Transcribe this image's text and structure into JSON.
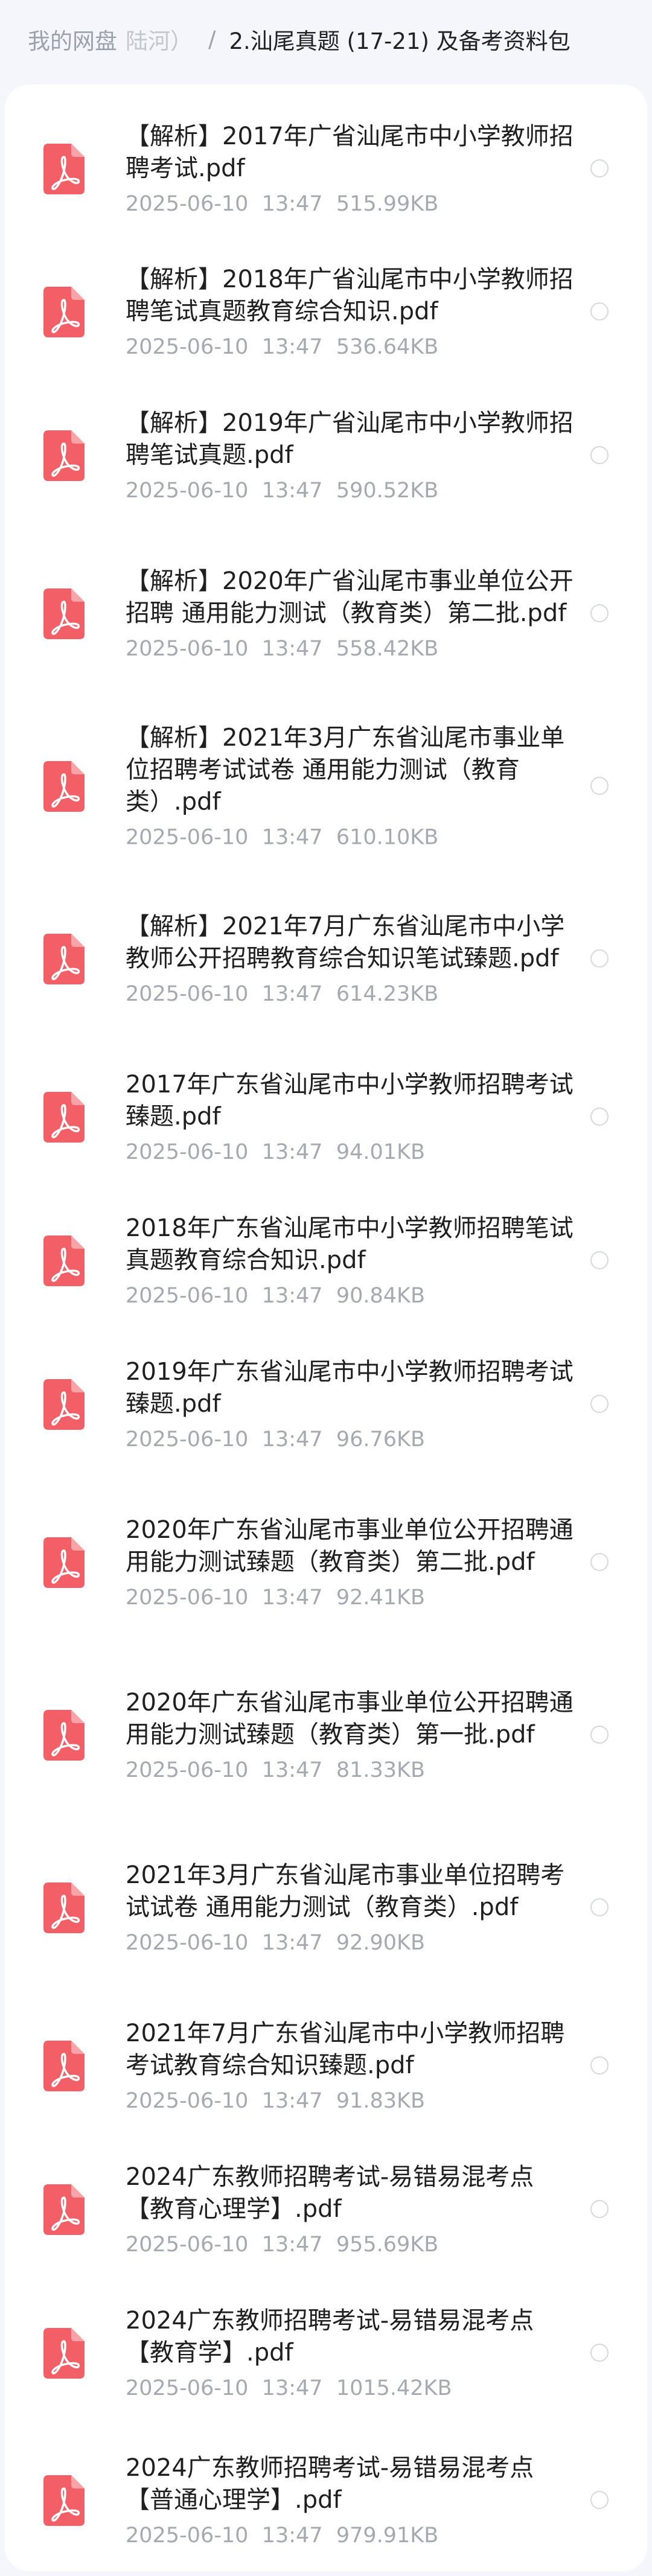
{
  "breadcrumb": {
    "root": "我的网盘",
    "middle": "陆河）",
    "separator": "/",
    "current": "2.汕尾真题 (17-21) 及备考资料包"
  },
  "colors": {
    "pdf_icon": "#f25f66",
    "background": "#f4f6fb"
  },
  "files": [
    {
      "name": "【解析】2017年广省汕尾市中小学教师招聘考试.pdf",
      "date": "2025-06-10",
      "time": "13:47",
      "size": "515.99KB",
      "icon": "pdf-icon"
    },
    {
      "name": "【解析】2018年广省汕尾市中小学教师招聘笔试真题教育综合知识.pdf",
      "date": "2025-06-10",
      "time": "13:47",
      "size": "536.64KB",
      "icon": "pdf-icon"
    },
    {
      "name": "【解析】2019年广省汕尾市中小学教师招聘笔试真题.pdf",
      "date": "2025-06-10",
      "time": "13:47",
      "size": "590.52KB",
      "icon": "pdf-icon"
    },
    {
      "name": "【解析】2020年广省汕尾市事业单位公开招聘 通用能力测试（教育类）第二批.pdf",
      "date": "2025-06-10",
      "time": "13:47",
      "size": "558.42KB",
      "icon": "pdf-icon"
    },
    {
      "name": "【解析】2021年3月广东省汕尾市事业单位招聘考试试卷 通用能力测试（教育类）.pdf",
      "date": "2025-06-10",
      "time": "13:47",
      "size": "610.10KB",
      "icon": "pdf-icon"
    },
    {
      "name": "【解析】2021年7月广东省汕尾市中小学教师公开招聘教育综合知识笔试臻题.pdf",
      "date": "2025-06-10",
      "time": "13:47",
      "size": "614.23KB",
      "icon": "pdf-icon"
    },
    {
      "name": "2017年广东省汕尾市中小学教师招聘考试臻题.pdf",
      "date": "2025-06-10",
      "time": "13:47",
      "size": "94.01KB",
      "icon": "pdf-icon"
    },
    {
      "name": "2018年广东省汕尾市中小学教师招聘笔试真题教育综合知识.pdf",
      "date": "2025-06-10",
      "time": "13:47",
      "size": "90.84KB",
      "icon": "pdf-icon"
    },
    {
      "name": "2019年广东省汕尾市中小学教师招聘考试臻题.pdf",
      "date": "2025-06-10",
      "time": "13:47",
      "size": "96.76KB",
      "icon": "pdf-icon"
    },
    {
      "name": "2020年广东省汕尾市事业单位公开招聘通用能力测试臻题（教育类）第二批.pdf",
      "date": "2025-06-10",
      "time": "13:47",
      "size": "92.41KB",
      "icon": "pdf-icon"
    },
    {
      "name": "2020年广东省汕尾市事业单位公开招聘通用能力测试臻题（教育类）第一批.pdf",
      "date": "2025-06-10",
      "time": "13:47",
      "size": "81.33KB",
      "icon": "pdf-icon"
    },
    {
      "name": "2021年3月广东省汕尾市事业单位招聘考试试卷 通用能力测试（教育类）.pdf",
      "date": "2025-06-10",
      "time": "13:47",
      "size": "92.90KB",
      "icon": "pdf-icon"
    },
    {
      "name": "2021年7月广东省汕尾市中小学教师招聘考试教育综合知识臻题.pdf",
      "date": "2025-06-10",
      "time": "13:47",
      "size": "91.83KB",
      "icon": "pdf-icon"
    },
    {
      "name": "2024广东教师招聘考试-易错易混考点【教育心理学】.pdf",
      "date": "2025-06-10",
      "time": "13:47",
      "size": "955.69KB",
      "icon": "pdf-icon"
    },
    {
      "name": "2024广东教师招聘考试-易错易混考点【教育学】.pdf",
      "date": "2025-06-10",
      "time": "13:47",
      "size": "1015.42KB",
      "icon": "pdf-icon"
    },
    {
      "name": "2024广东教师招聘考试-易错易混考点【普通心理学】.pdf",
      "date": "2025-06-10",
      "time": "13:47",
      "size": "979.91KB",
      "icon": "pdf-icon"
    }
  ]
}
